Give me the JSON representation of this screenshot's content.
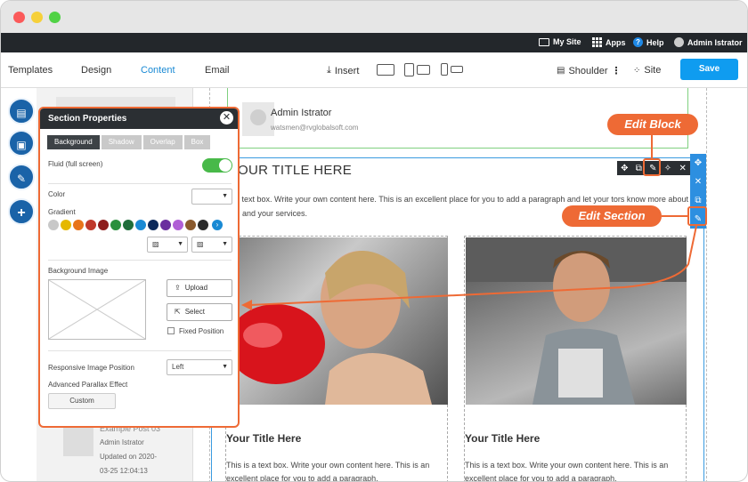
{
  "topbar": {
    "my_site": "My Site",
    "apps": "Apps",
    "help": "Help",
    "user": "Admin Istrator"
  },
  "menu": {
    "tabs": [
      "Templates",
      "Design",
      "Content",
      "Email"
    ],
    "active_tab": "Content",
    "insert": "Insert",
    "shoulder": "Shoulder",
    "site": "Site",
    "save": "Save"
  },
  "author": {
    "name": "Admin Istrator",
    "email": "watsmen@rvglobalsoft.com"
  },
  "section": {
    "title": "OUR TITLE HERE",
    "text": "is a text box. Write your own content here. This is an excellent place for you to add a paragraph and let your tors know more about you and your services."
  },
  "cards": [
    {
      "title": "Your Title Here",
      "text": "This is a text box. Write your own content here. This is an excellent place for you to add a paragraph."
    },
    {
      "title": "Your Title Here",
      "text": "This is a text box. Write your own content here. This is an excellent place for you to add a paragraph."
    }
  ],
  "blog": {
    "title": "Example Post 03",
    "author": "Admin Istrator",
    "updated_line1": "Updated on 2020-",
    "updated_line2": "03-25 12:04:13"
  },
  "section_properties": {
    "title": "Section Properties",
    "tabs": [
      "Background",
      "Shadow",
      "Overlap",
      "Box"
    ],
    "active_tab": "Background",
    "fluid_label": "Fluid (full screen)",
    "fluid_on": true,
    "color_label": "Color",
    "gradient_label": "Gradient",
    "gradient_swatches": [
      "#c8c8c8",
      "#e5b800",
      "#e8741a",
      "#c0392b",
      "#8e1c1c",
      "#2a8f3c",
      "#1f6e3a",
      "#1a8ad4",
      "#0d2a5a",
      "#6a2e9e",
      "#b05fd6",
      "#8a5a2e",
      "#2b2b2b"
    ],
    "background_image_label": "Background Image",
    "upload_label": "Upload",
    "select_label": "Select",
    "fixed_position_label": "Fixed Position",
    "responsive_label": "Responsive Image Position",
    "responsive_value": "Left",
    "parallax_label": "Advanced Parallax Effect",
    "custom_label": "Custom"
  },
  "callouts": {
    "edit_block": "Edit Block",
    "edit_section": "Edit Section"
  },
  "colors": {
    "accent_orange": "#ee6a35",
    "save_blue": "#0f9cf0",
    "topbar_dark": "#23272b",
    "toggle_green": "#48b949"
  }
}
